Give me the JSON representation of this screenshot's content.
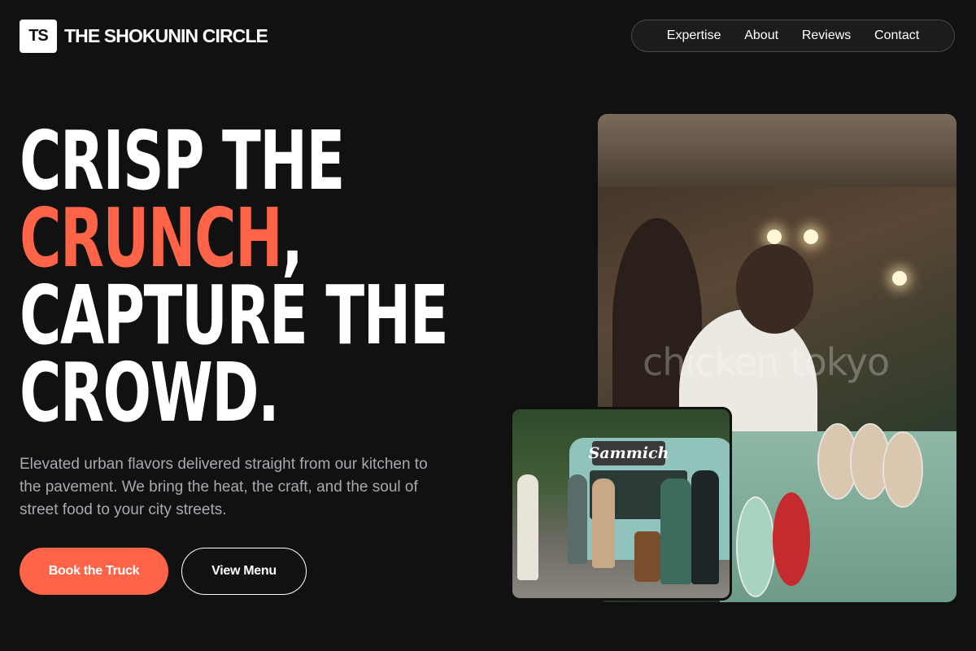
{
  "brand": {
    "mark": "TS",
    "name": "THE SHOKUNIN CIRCLE"
  },
  "nav": {
    "items": [
      {
        "label": "Expertise"
      },
      {
        "label": "About"
      },
      {
        "label": "Reviews"
      },
      {
        "label": "Contact"
      }
    ]
  },
  "hero": {
    "headline": {
      "line1": "CRISP THE",
      "line2_accent": "CRUNCH",
      "line2_rest": ",",
      "line3": "CAPTURE THE",
      "line4": "CROWD."
    },
    "subtitle": "Elevated urban flavors delivered straight from our kitchen to the pavement. We bring the heat, the craft, and the soul of street food to your city streets.",
    "primary_cta": "Book the Truck",
    "secondary_cta": "View Menu"
  },
  "images": {
    "main_watermark": "chicken tokyo",
    "inset_truck_sign": "Sammich"
  },
  "colors": {
    "background": "#111112",
    "accent": "#ff6448",
    "muted_text": "#a9a9b0"
  }
}
